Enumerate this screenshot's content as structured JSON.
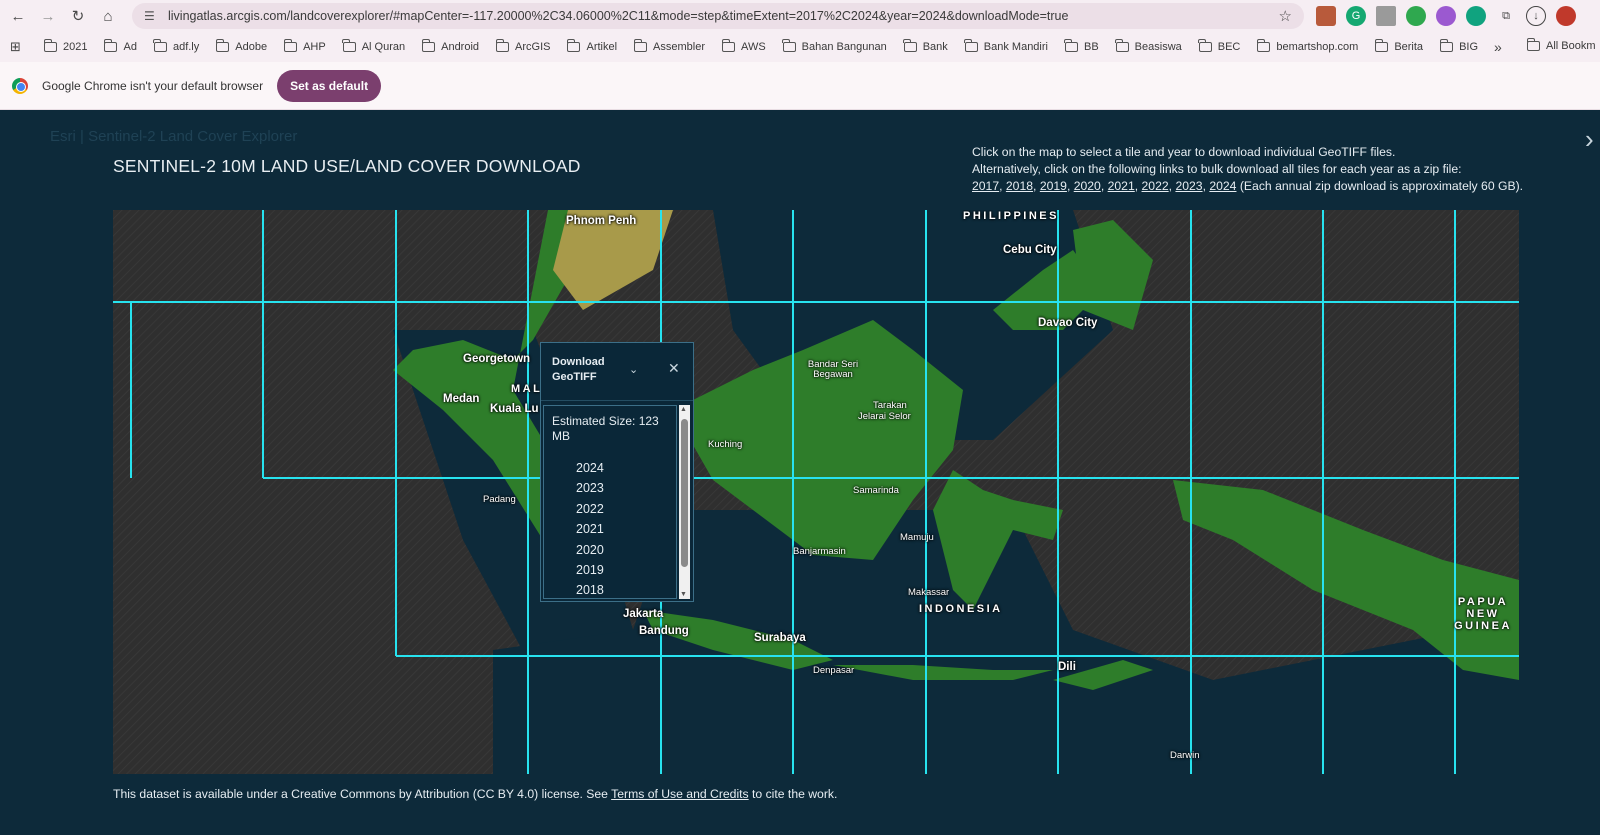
{
  "browser": {
    "url": "livingatlas.arcgis.com/landcoverexplorer/#mapCenter=-117.20000%2C34.06000%2C11&mode=step&timeExtent=2017%2C2024&year=2024&downloadMode=true",
    "bookmarks": [
      "2021",
      "Ad",
      "adf.ly",
      "Adobe",
      "AHP",
      "Al Quran",
      "Android",
      "ArcGIS",
      "Artikel",
      "Assembler",
      "AWS",
      "Bahan Bangunan",
      "Bank",
      "Bank Mandiri",
      "BB",
      "Beasiswa",
      "BEC",
      "bemartshop.com",
      "Berita",
      "BIG"
    ],
    "all_bookmarks": "All Bookm",
    "infobar_text": "Google Chrome isn't your default browser",
    "set_default_label": "Set as default"
  },
  "page": {
    "bg_title": "Esri | Sentinel-2 Land Cover Explorer",
    "title": "SENTINEL-2 10M LAND USE/LAND COVER DOWNLOAD",
    "info_line1": "Click on the map to select a tile and year to download individual GeoTIFF files.",
    "info_line2": "Alternatively, click on the following links to bulk download all tiles for each year as a zip file:",
    "bulk_years": [
      "2017",
      "2018",
      "2019",
      "2020",
      "2021",
      "2022",
      "2023",
      "2024"
    ],
    "bulk_note": "(Each annual zip download is approximately 60 GB).",
    "footer_pre": "This dataset is available under a Creative Commons by Attribution (CC BY 4.0) license. See ",
    "footer_link": "Terms of Use and Credits",
    "footer_post": " to cite the work."
  },
  "map": {
    "labels": {
      "phnom_penh": "Phnom Penh",
      "philippines": "PHILIPPINES",
      "cebu": "Cebu City",
      "davao": "Davao City",
      "georgetown": "Georgetown",
      "mal": "MAL",
      "medan": "Medan",
      "kuala_lumpur": "Kuala Lu",
      "bandar": "Bandar Seri Begawan",
      "tarakan": "Tarakan",
      "jelarai": "Jelarai Selor",
      "kuching": "Kuching",
      "samarinda": "Samarinda",
      "padang": "Padang",
      "mamuju": "Mamuju",
      "banjarmasin": "Banjarmasin",
      "makassar": "Makassar",
      "indonesia": "INDONESIA",
      "jakarta": "Jakarta",
      "bandung": "Bandung",
      "surabaya": "Surabaya",
      "denpasar": "Denpasar",
      "dili": "Dili",
      "darwin": "Darwin",
      "papua": "PAPUA NEW GUINEA"
    }
  },
  "popup": {
    "title": "Download GeoTIFF",
    "estimated_size": "Estimated Size: 123 MB",
    "years": [
      "2024",
      "2023",
      "2022",
      "2021",
      "2020",
      "2019",
      "2018"
    ]
  }
}
